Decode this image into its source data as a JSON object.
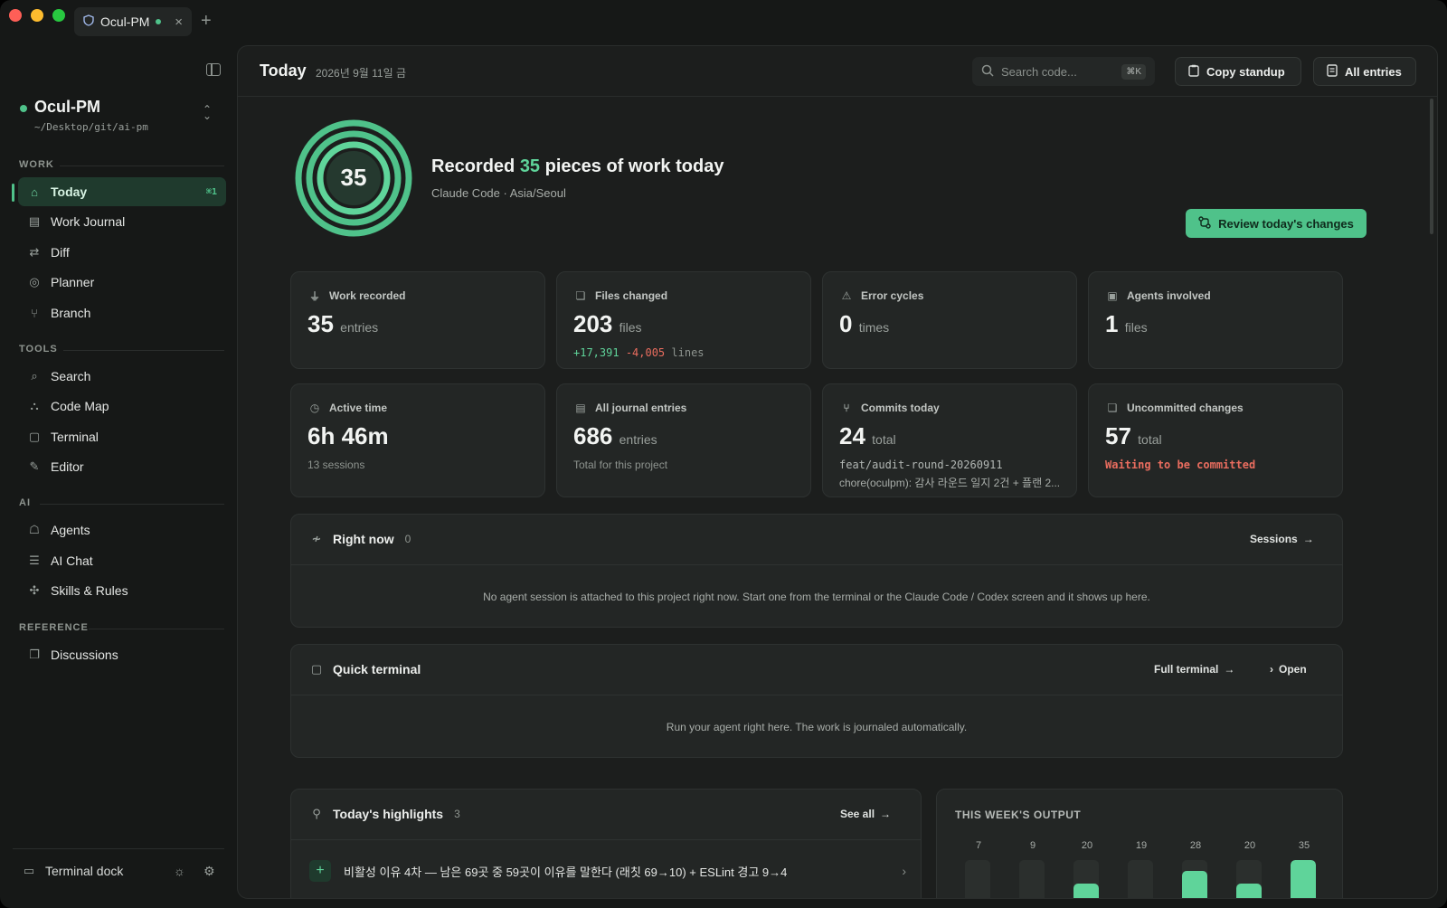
{
  "tab": {
    "title": "Ocul-PM"
  },
  "project": {
    "name": "Ocul-PM",
    "path": "~/Desktop/git/ai-pm"
  },
  "sidebar": {
    "sections": [
      {
        "label": "WORK",
        "items": [
          {
            "label": "Today",
            "icon": "home-icon",
            "kbd": "⌘1",
            "active": true
          },
          {
            "label": "Work Journal",
            "icon": "journal-icon"
          },
          {
            "label": "Diff",
            "icon": "diff-icon"
          },
          {
            "label": "Planner",
            "icon": "target-icon"
          },
          {
            "label": "Branch",
            "icon": "branch-icon"
          }
        ]
      },
      {
        "label": "TOOLS",
        "items": [
          {
            "label": "Search",
            "icon": "search-icon"
          },
          {
            "label": "Code Map",
            "icon": "codemap-icon"
          },
          {
            "label": "Terminal",
            "icon": "terminal-icon"
          },
          {
            "label": "Editor",
            "icon": "editor-icon"
          }
        ]
      },
      {
        "label": "AI",
        "items": [
          {
            "label": "Agents",
            "icon": "robot-icon"
          },
          {
            "label": "AI Chat",
            "icon": "chat-icon"
          },
          {
            "label": "Skills & Rules",
            "icon": "puzzle-icon"
          }
        ]
      },
      {
        "label": "REFERENCE",
        "items": [
          {
            "label": "Discussions",
            "icon": "discussion-icon"
          }
        ]
      }
    ],
    "footer": {
      "dock_label": "Terminal dock"
    }
  },
  "header": {
    "title": "Today",
    "date": "2026년 9월 11일 금",
    "search_placeholder": "Search code...",
    "search_kbd": "⌘K",
    "copy_label": "Copy standup",
    "all_label": "All entries"
  },
  "hero": {
    "count": "35",
    "title_prefix": "Recorded ",
    "title_suffix": " pieces of work today",
    "subtitle": "Claude Code · Asia/Seoul",
    "review_label": "Review today's changes"
  },
  "stats": [
    {
      "label": "Work recorded",
      "value": "35",
      "unit": "entries"
    },
    {
      "label": "Files changed",
      "value": "203",
      "unit": "files",
      "plus": "+17,391",
      "minus": "-4,005",
      "lines": "lines"
    },
    {
      "label": "Error cycles",
      "value": "0",
      "unit": "times"
    },
    {
      "label": "Agents involved",
      "value": "1",
      "unit": "files"
    },
    {
      "label": "Active time",
      "value": "6h 46m",
      "sub": "13 sessions"
    },
    {
      "label": "All journal entries",
      "value": "686",
      "unit": "entries",
      "sub": "Total for this project"
    },
    {
      "label": "Commits today",
      "value": "24",
      "unit": "total",
      "sub": "feat/audit-round-20260911",
      "sub2": "chore(oculpm): 감사 라운드 일지 2건 + 플랜 2..."
    },
    {
      "label": "Uncommitted changes",
      "value": "57",
      "unit": "total",
      "sub": "Waiting to be committed"
    }
  ],
  "right_now": {
    "title": "Right now",
    "count": "0",
    "link": "Sessions",
    "empty": "No agent session is attached to this project right now. Start one from the terminal or the Claude Code / Codex screen and it shows up here."
  },
  "quick_terminal": {
    "title": "Quick terminal",
    "full_link": "Full terminal",
    "open_link": "Open",
    "empty": "Run your agent right here. The work is journaled automatically."
  },
  "highlights": {
    "title": "Today's highlights",
    "count": "3",
    "link": "See all",
    "items": [
      "비활성 이유 4차 — 남은 69곳 중 59곳이 이유를 말한다 (래칫 69→10) + ESLint 경고 9→4"
    ]
  },
  "week": {
    "title": "THIS WEEK'S OUTPUT",
    "days": [
      {
        "value": 7
      },
      {
        "value": 9
      },
      {
        "value": 20
      },
      {
        "value": 19
      },
      {
        "value": 28
      },
      {
        "value": 20
      },
      {
        "value": 35
      }
    ],
    "max": 35
  },
  "colors": {
    "accent": "#4fc28a",
    "danger": "#ea6d5f"
  }
}
